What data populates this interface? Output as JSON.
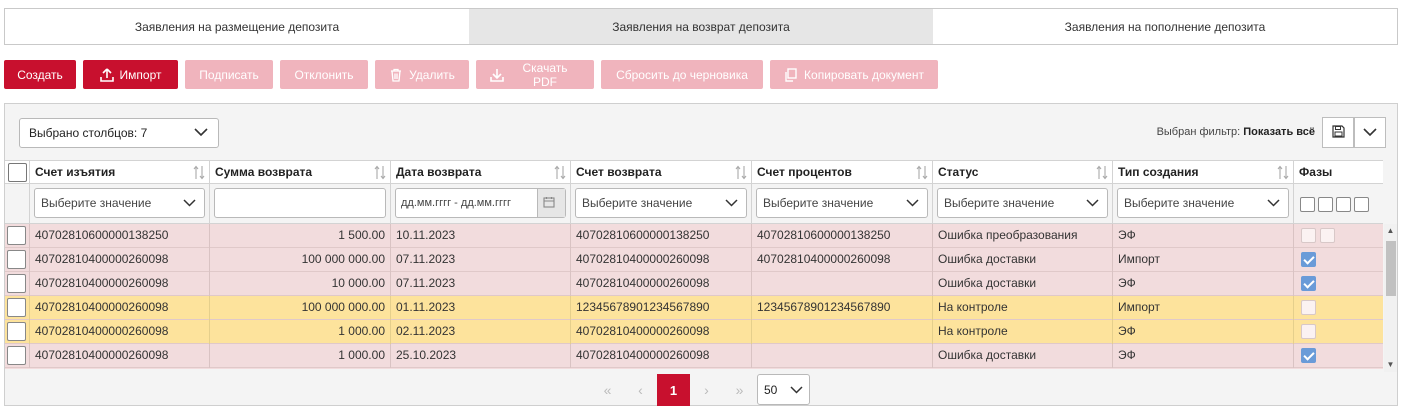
{
  "tabs": [
    {
      "label": "Заявления на размещение депозита",
      "active": false
    },
    {
      "label": "Заявления на возврат депозита",
      "active": true
    },
    {
      "label": "Заявления на пополнение депозита",
      "active": false
    }
  ],
  "toolbar": {
    "create": "Создать",
    "import": "Импорт",
    "sign": "Подписать",
    "reject": "Отклонить",
    "delete": "Удалить",
    "download_pdf": "Скачать PDF",
    "reset_draft": "Сбросить до черновика",
    "copy_doc": "Копировать документ"
  },
  "columns_selector": "Выбрано столбцов: 7",
  "filter_info": {
    "label": "Выбран фильтр:",
    "value": "Показать всё"
  },
  "columns": [
    "Счет изъятия",
    "Сумма возврата",
    "Дата возврата",
    "Счет возврата",
    "Счет процентов",
    "Статус",
    "Тип создания",
    "Фазы"
  ],
  "filters": {
    "select_placeholder": "Выберите значение",
    "date_placeholder": "дд.мм.гггг - дд.мм.гггг"
  },
  "rows": [
    {
      "account": "40702810600000138250",
      "amount": "1 500.00",
      "date": "10.11.2023",
      "return_account": "40702810600000138250",
      "interest_account": "40702810600000138250",
      "status": "Ошибка преобразования",
      "type": "ЭФ",
      "style": "pink",
      "phase": "double"
    },
    {
      "account": "40702810400000260098",
      "amount": "100 000 000.00",
      "date": "07.11.2023",
      "return_account": "40702810400000260098",
      "interest_account": "40702810400000260098",
      "status": "Ошибка доставки",
      "type": "Импорт",
      "style": "pink",
      "phase": "checked"
    },
    {
      "account": "40702810400000260098",
      "amount": "10 000.00",
      "date": "07.11.2023",
      "return_account": "40702810400000260098",
      "interest_account": "",
      "status": "Ошибка доставки",
      "type": "ЭФ",
      "style": "pink",
      "phase": "checked"
    },
    {
      "account": "40702810400000260098",
      "amount": "100 000 000.00",
      "date": "01.11.2023",
      "return_account": "12345678901234567890",
      "interest_account": "12345678901234567890",
      "status": "На контроле",
      "type": "Импорт",
      "style": "yellow",
      "phase": "empty"
    },
    {
      "account": "40702810400000260098",
      "amount": "1 000.00",
      "date": "02.11.2023",
      "return_account": "40702810400000260098",
      "interest_account": "",
      "status": "На контроле",
      "type": "ЭФ",
      "style": "yellow",
      "phase": "empty"
    },
    {
      "account": "40702810400000260098",
      "amount": "1 000.00",
      "date": "25.10.2023",
      "return_account": "40702810400000260098",
      "interest_account": "",
      "status": "Ошибка доставки",
      "type": "ЭФ",
      "style": "pink",
      "phase": "checked"
    }
  ],
  "pagination": {
    "first": "«",
    "prev": "‹",
    "current": "1",
    "next": "›",
    "last": "»",
    "page_size": "50"
  },
  "colors": {
    "primary": "#c8102e",
    "disabled": "#f0b4bd",
    "row_error": "#f2dcdd",
    "row_control": "#fde39c",
    "check": "#6a9bd8"
  }
}
